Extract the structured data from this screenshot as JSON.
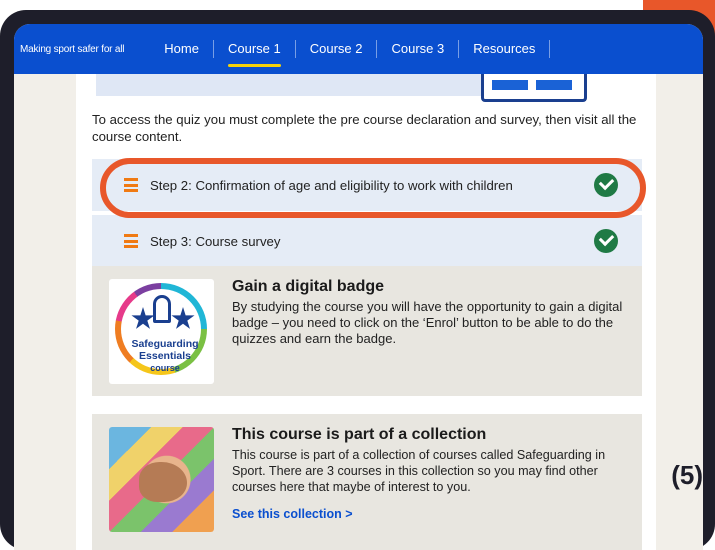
{
  "nav": {
    "brand": "Making sport safer for all",
    "items": [
      {
        "label": "Home",
        "active": false
      },
      {
        "label": "Course 1",
        "active": true
      },
      {
        "label": "Course 2",
        "active": false
      },
      {
        "label": "Course 3",
        "active": false
      },
      {
        "label": "Resources",
        "active": false
      }
    ]
  },
  "intro": "To access the quiz you must complete the pre course declaration and survey, then visit all the course content.",
  "steps": [
    {
      "label": "Step 2: Confirmation of age and eligibility to work with children",
      "complete": true
    },
    {
      "label": "Step 3: Course survey",
      "complete": true
    }
  ],
  "badge_card": {
    "title": "Gain a digital badge",
    "text": "By studying the course you will have the opportunity to gain a digital badge – you need to click on the ‘Enrol’ button to be able to do the quizzes and earn the badge.",
    "badge_line1": "Safeguarding",
    "badge_line2": "Essentials",
    "badge_line3": "course"
  },
  "collection_card": {
    "title": "This course is part of a collection",
    "text": "This course is part of a collection of courses called Safeguarding in Sport. There are 3 courses in this collection so you may find other courses here that maybe of interest to you.",
    "link": "See this collection >"
  },
  "page_number": "(5)",
  "colors": {
    "nav_bg": "#0a4fcf",
    "highlight": "#e8572a",
    "check": "#1f7a45",
    "step_icon": "#f07a13",
    "link": "#0a4fcf"
  }
}
